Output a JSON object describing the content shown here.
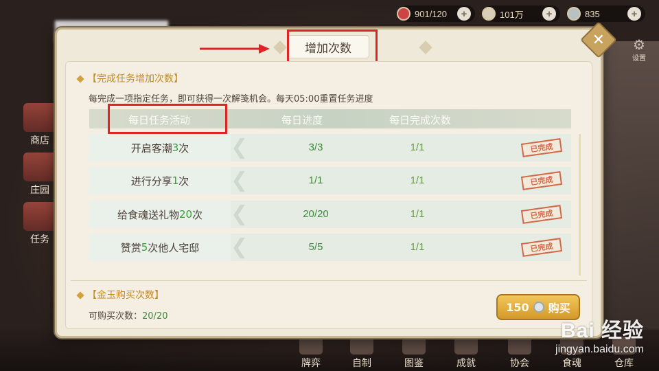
{
  "top_bar": {
    "resources": [
      {
        "icon": "heart-icon",
        "value": "901/120"
      },
      {
        "icon": "feather-icon",
        "value": "101万"
      },
      {
        "icon": "coin-icon",
        "value": "835"
      }
    ]
  },
  "settings_label": "设置",
  "left_nav": [
    "商店",
    "庄园",
    "任务"
  ],
  "bottom_nav": [
    "牌弈",
    "自制",
    "图鉴",
    "成就",
    "协会",
    "食魂",
    "仓库"
  ],
  "dialog": {
    "title": "增加次数",
    "task_section": {
      "heading": "【完成任务增加次数】",
      "description": "每完成一项指定任务，即可获得一次解笺机会。每天05:00重置任务进度",
      "headers": [
        "每日任务活动",
        "每日进度",
        "每日完成次数"
      ],
      "rows": [
        {
          "pre": "开启客潮",
          "num": "3",
          "post": "次",
          "progress": "3/3",
          "count": "1/1",
          "status": "已完成"
        },
        {
          "pre": "进行分享",
          "num": "1",
          "post": "次",
          "progress": "1/1",
          "count": "1/1",
          "status": "已完成"
        },
        {
          "pre": "给食魂送礼物",
          "num": "20",
          "post": "次",
          "progress": "20/20",
          "count": "1/1",
          "status": "已完成"
        },
        {
          "pre": "赞赏",
          "num": "5",
          "post": "次他人宅邸",
          "progress": "5/5",
          "count": "1/1",
          "status": "已完成"
        }
      ]
    },
    "buy_section": {
      "heading": "【金玉购买次数】",
      "label": "可购买次数：",
      "value": "20/20",
      "price": "150",
      "button_label": "购买"
    }
  },
  "watermark": {
    "brand": "Bai 经验",
    "url": "jingyan.baidu.com"
  },
  "colors": {
    "highlight_box": "#e02424",
    "accent_gold": "#c28a23",
    "progress_green": "#3f8a3a"
  }
}
